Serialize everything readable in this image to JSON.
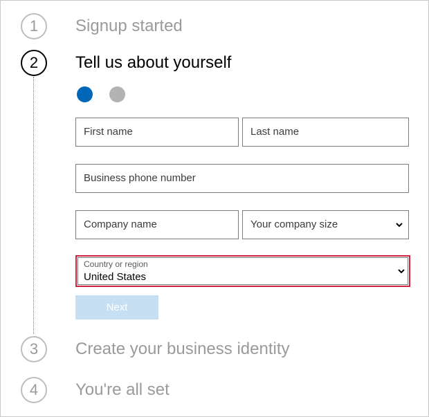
{
  "steps": [
    {
      "number": "1",
      "title": "Signup started"
    },
    {
      "number": "2",
      "title": "Tell us about yourself"
    },
    {
      "number": "3",
      "title": "Create your business identity"
    },
    {
      "number": "4",
      "title": "You're all set"
    }
  ],
  "progress": {
    "current_page": 1,
    "total_pages": 2,
    "active_color": "#0067b8",
    "inactive_color": "#b3b3b3"
  },
  "form": {
    "first_name_placeholder": "First name",
    "last_name_placeholder": "Last name",
    "phone_placeholder": "Business phone number",
    "company_name_placeholder": "Company name",
    "company_size_selected": "Your company size",
    "country_label": "Country or region",
    "country_value": "United States",
    "next_label": "Next"
  },
  "colors": {
    "highlight_border": "#d0223a",
    "next_button_bg": "#c6dff3"
  }
}
